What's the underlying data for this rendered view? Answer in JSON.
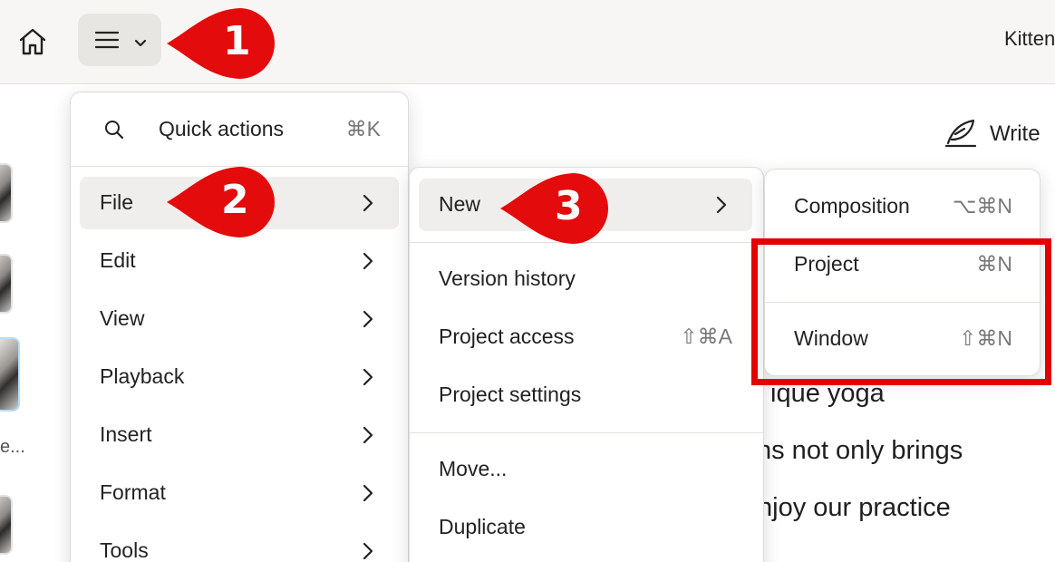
{
  "topbar": {
    "doc_title": "Kitten"
  },
  "sidebar": {
    "thumb_label": "e..."
  },
  "write_button": {
    "label": "Write"
  },
  "background_text": {
    "line1": "ique yoga",
    "line2": "ns not only brings",
    "line3": "njoy our practice"
  },
  "main_menu": {
    "quick_actions": {
      "label": "Quick actions",
      "shortcut": "⌘K"
    },
    "items": [
      {
        "label": "File"
      },
      {
        "label": "Edit"
      },
      {
        "label": "View"
      },
      {
        "label": "Playback"
      },
      {
        "label": "Insert"
      },
      {
        "label": "Format"
      },
      {
        "label": "Tools"
      }
    ]
  },
  "file_menu": {
    "new": {
      "label": "New"
    },
    "version_history": {
      "label": "Version history"
    },
    "project_access": {
      "label": "Project access",
      "shortcut": "⇧⌘A"
    },
    "project_settings": {
      "label": "Project settings"
    },
    "move": {
      "label": "Move..."
    },
    "duplicate": {
      "label": "Duplicate"
    }
  },
  "new_menu": {
    "composition": {
      "label": "Composition",
      "shortcut": "⌥⌘N"
    },
    "project": {
      "label": "Project",
      "shortcut": "⌘N"
    },
    "window": {
      "label": "Window",
      "shortcut": "⇧⌘N"
    }
  },
  "callouts": {
    "one": "1",
    "two": "2",
    "three": "3"
  },
  "colors": {
    "callout_red": "#e30b0b",
    "highlight_box": "#e30000",
    "menu_highlight": "#efeeec"
  },
  "icons": [
    "home-icon",
    "hamburger-icon",
    "chevron-down-icon",
    "search-icon",
    "chevron-right-icon",
    "quill-icon"
  ]
}
